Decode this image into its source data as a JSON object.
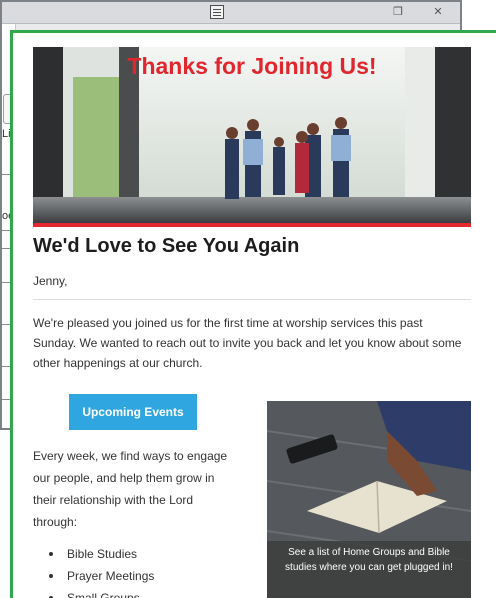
{
  "background_window": {
    "fragment_1": "Lis",
    "fragment_2": "oe"
  },
  "email": {
    "hero": {
      "title": "Thanks for Joining Us!"
    },
    "heading": "We'd Love to See You Again",
    "greeting": "Jenny,",
    "intro": "We're pleased you joined us for the first time at worship services this past Sunday. We wanted to reach out to invite you back and let you know about some other happenings at our church.",
    "cta_button": "Upcoming Events",
    "engage_text": "Every week, we find ways to engage our people, and help them grow in their relationship with the Lord through:",
    "activities": [
      "Bible Studies",
      "Prayer Meetings",
      "Small Groups"
    ],
    "image_caption": "See a list of Home Groups and Bible studies where you can get plugged in!"
  },
  "colors": {
    "frame_green": "#2ea84a",
    "hero_red": "#e0262e",
    "button_blue": "#2fa6e0"
  }
}
